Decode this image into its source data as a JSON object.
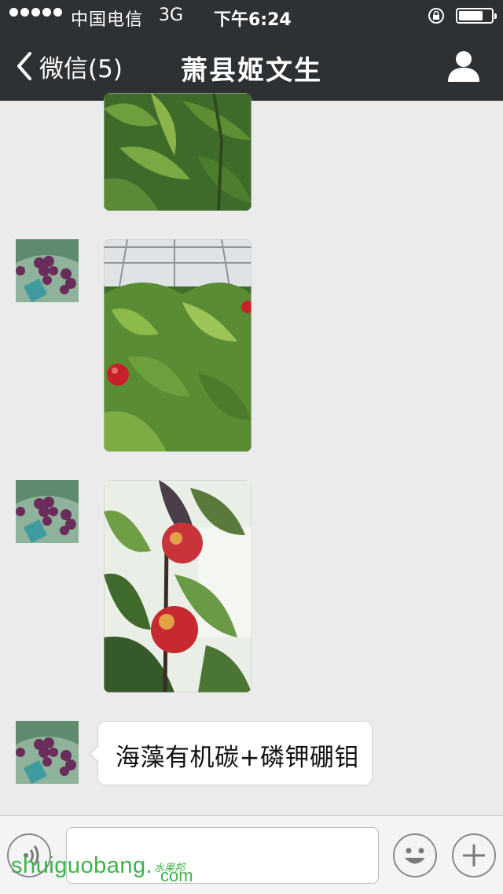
{
  "status_bar": {
    "carrier": "中国电信",
    "network": "3G",
    "time": "下午6:24",
    "signal_dots": 5,
    "battery_level": 0.75
  },
  "nav": {
    "back_label": "微信(5)",
    "title": "萧县姬文生",
    "profile_icon": "person-icon"
  },
  "messages": [
    {
      "type": "image",
      "subject": "peach-tree-foliage",
      "avatar": "grapes-avatar"
    },
    {
      "type": "image",
      "subject": "peach-orchard-greenhouse",
      "avatar": "grapes-avatar"
    },
    {
      "type": "image",
      "subject": "nectarines-on-branch",
      "avatar": "grapes-avatar"
    },
    {
      "type": "text",
      "text": "海藻有机碳+磷钾硼钼",
      "avatar": "grapes-avatar"
    }
  ],
  "input_bar": {
    "voice_icon": "voice-icon",
    "emoji_icon": "emoji-icon",
    "plus_icon": "plus-icon",
    "text_value": ""
  },
  "watermark": {
    "text": "shuiguobang.",
    "cn": "水果邦",
    "com": "com"
  },
  "colors": {
    "topbar": "#2e3134",
    "background": "#ebebeb",
    "watermark": "#3db34a"
  }
}
